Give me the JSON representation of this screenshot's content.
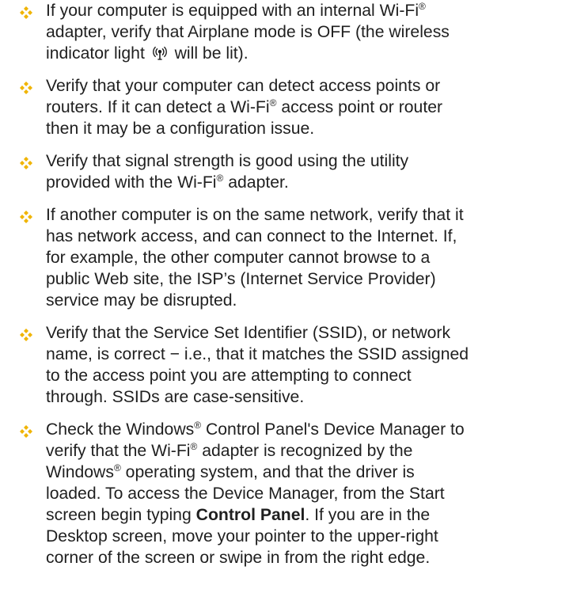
{
  "bullets": [
    {
      "lines": [
        [
          "If your computer is equipped with an internal Wi-Fi",
          "®",
          ""
        ],
        [
          "adapter, verify that Airplane mode is OFF (the wireless"
        ],
        [
          "indicator light ",
          "ICON",
          " will be lit)."
        ]
      ]
    },
    {
      "lines": [
        [
          "Verify that your computer can detect access points or"
        ],
        [
          "routers. If it can detect a Wi-Fi",
          "®",
          " access point or router"
        ],
        [
          "then it may be a configuration issue."
        ]
      ]
    },
    {
      "lines": [
        [
          "Verify that signal strength is good using the utility"
        ],
        [
          "provided with the Wi-Fi",
          "®",
          " adapter."
        ]
      ]
    },
    {
      "lines": [
        [
          "If another computer is on the same network, verify that it"
        ],
        [
          "has network access, and can connect to the Internet. If,"
        ],
        [
          "for example, the other computer cannot browse to a"
        ],
        [
          "public Web site, the ISP’s (Internet Service Provider)"
        ],
        [
          "service may be disrupted."
        ]
      ]
    },
    {
      "lines": [
        [
          "Verify that the Service Set Identifier (SSID), or network"
        ],
        [
          "name, is correct − i.e., that it matches the SSID assigned"
        ],
        [
          "to the access point you are attempting to connect"
        ],
        [
          "through. SSIDs are case-sensitive."
        ]
      ]
    },
    {
      "lines": [
        [
          "Check the Windows",
          "®",
          " Control Panel's Device Manager to"
        ],
        [
          "verify that the Wi-Fi",
          "®",
          " adapter is recognized by the"
        ],
        [
          "Windows",
          "®",
          " operating system, and that the driver is"
        ],
        [
          "loaded. To access the Device Manager, from the Start"
        ],
        [
          "screen begin typing ",
          "BOLD:Control Panel",
          ". If you are in the"
        ],
        [
          "Desktop screen, move your pointer to the upper-right"
        ],
        [
          "corner of the screen or swipe in from the right edge."
        ]
      ]
    }
  ],
  "colors": {
    "bullet_diamond": "#f0b400",
    "text": "#1f1f1f"
  },
  "icons": {
    "bullet": "diamond-bullet-icon",
    "wireless_indicator": "wireless-indicator-icon"
  }
}
